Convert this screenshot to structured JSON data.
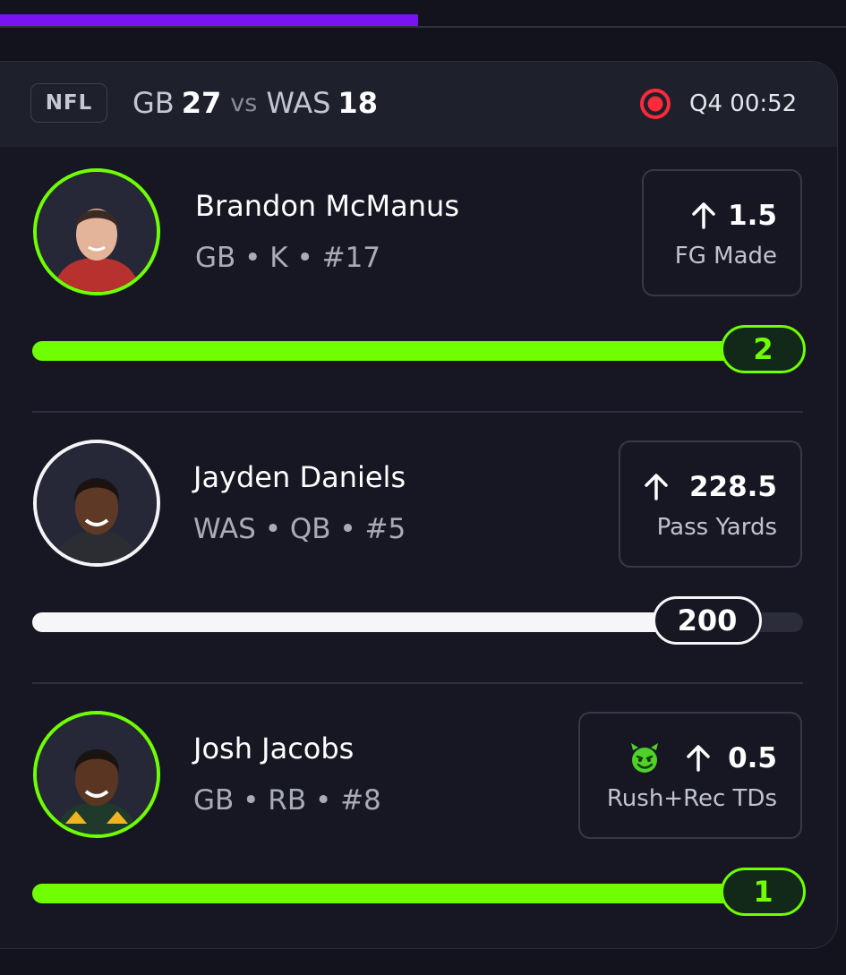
{
  "game": {
    "league": "NFL",
    "home_team": "GB",
    "home_score": "27",
    "vs": "vs",
    "away_team": "WAS",
    "away_score": "18",
    "live_icon": "live-record-icon",
    "clock": "Q4 00:52",
    "top_progress": 0.49
  },
  "players": [
    {
      "name": "Brandon McManus",
      "meta": "GB • K • #17",
      "direction": "over-arrow-up-icon",
      "line": "1.5",
      "stat": "FG Made",
      "current": "2",
      "progress": 1.0,
      "status_color": "#6fff00"
    },
    {
      "name": "Jayden Daniels",
      "meta": "WAS • QB • #5",
      "direction": "over-arrow-up-icon",
      "line": "228.5",
      "stat": "Pass Yards",
      "current": "200",
      "progress": 0.875,
      "status_color": "#f6f6f8"
    },
    {
      "name": "Josh Jacobs",
      "meta": "GB • RB • #8",
      "badge_icon": "green-devil-emoji-icon",
      "direction": "over-arrow-up-icon",
      "line": "0.5",
      "stat": "Rush+Rec TDs",
      "current": "1",
      "progress": 1.0,
      "status_color": "#6fff00"
    }
  ],
  "colors": {
    "background": "#12131d",
    "card": "#161722",
    "accent_green": "#6fff00",
    "accent_purple": "#7a12f2",
    "live_red": "#ff2a3a"
  }
}
